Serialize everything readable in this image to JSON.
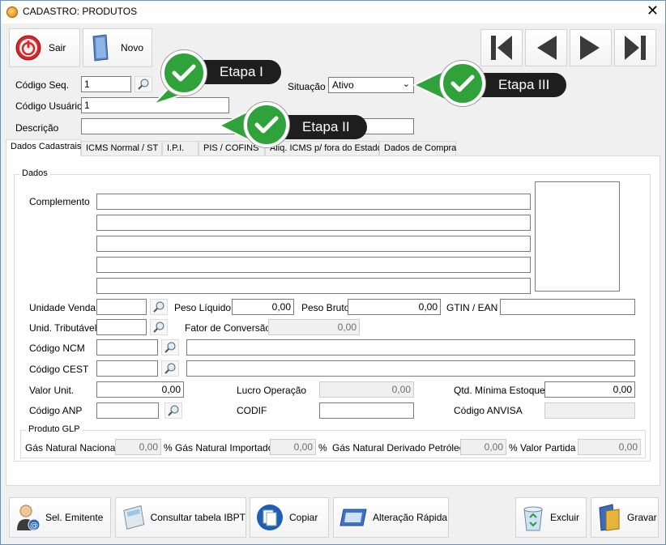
{
  "window": {
    "title": "CADASTRO: PRODUTOS"
  },
  "toolbar": {
    "sair": "Sair",
    "novo": "Novo"
  },
  "header": {
    "codigo_seq_label": "Código Seq.",
    "codigo_seq_value": "1",
    "codigo_usuario_label": "Código Usuário",
    "codigo_usuario_value": "1",
    "descricao_label": "Descrição",
    "descricao_value": "",
    "situacao_label": "Situação",
    "situacao_value": "Ativo"
  },
  "callouts": {
    "etapa1": "Etapa I",
    "etapa2": "Etapa II",
    "etapa3": "Etapa III"
  },
  "tabs": [
    {
      "label": "Dados Cadastrais"
    },
    {
      "label": "ICMS Normal / ST"
    },
    {
      "label": "I.P.I."
    },
    {
      "label": "PIS / COFINS"
    },
    {
      "label": "Aliq. ICMS p/ fora do Estado"
    },
    {
      "label": "Dados de Compra"
    }
  ],
  "dados": {
    "group_title": "Dados",
    "complemento_label": "Complemento",
    "unidade_venda_label": "Unidade Venda",
    "unidade_venda_value": "",
    "peso_liquido_label": "Peso Líquido",
    "peso_liquido_value": "0,00",
    "peso_bruto_label": "Peso Bruto",
    "peso_bruto_value": "0,00",
    "gtin_label": "GTIN / EAN",
    "gtin_value": "",
    "unid_tributavel_label": "Unid. Tributável",
    "unid_tributavel_value": "",
    "fator_conversao_label": "Fator de Conversão",
    "fator_conversao_value": "0,00",
    "codigo_ncm_label": "Código NCM",
    "codigo_cest_label": "Código CEST",
    "valor_unit_label": "Valor Unit.",
    "valor_unit_value": "0,00",
    "lucro_operacao_label": "Lucro Operação",
    "lucro_operacao_value": "0,00",
    "qtd_minima_label": "Qtd. Mínima Estoque",
    "qtd_minima_value": "0,00",
    "codigo_anp_label": "Código ANP",
    "codif_label": "CODIF",
    "codigo_anvisa_label": "Código ANVISA"
  },
  "glp": {
    "group_title": "Produto GLP",
    "gas_nacional_label": "Gás Natural Nacional",
    "gas_nacional_value": "0,00",
    "gas_importado_label": "Gás Natural Importado",
    "gas_importado_value": "0,00",
    "gas_derivado_label": "Gás Natural Derivado Petróleo",
    "gas_derivado_value": "0,00",
    "valor_partida_label": "Valor Partida",
    "valor_partida_value": "0,00",
    "percent": "%"
  },
  "bottom": {
    "sel_emitente": "Sel. Emitente",
    "consultar_ibpt": "Consultar tabela IBPT",
    "copiar": "Copiar",
    "alteracao_rapida": "Alteração Rápida",
    "excluir": "Excluir",
    "gravar": "Gravar"
  },
  "colors": {
    "check_green": "#2fa33a",
    "callout_dark": "#1e1e1e",
    "power_red": "#d9262b"
  }
}
